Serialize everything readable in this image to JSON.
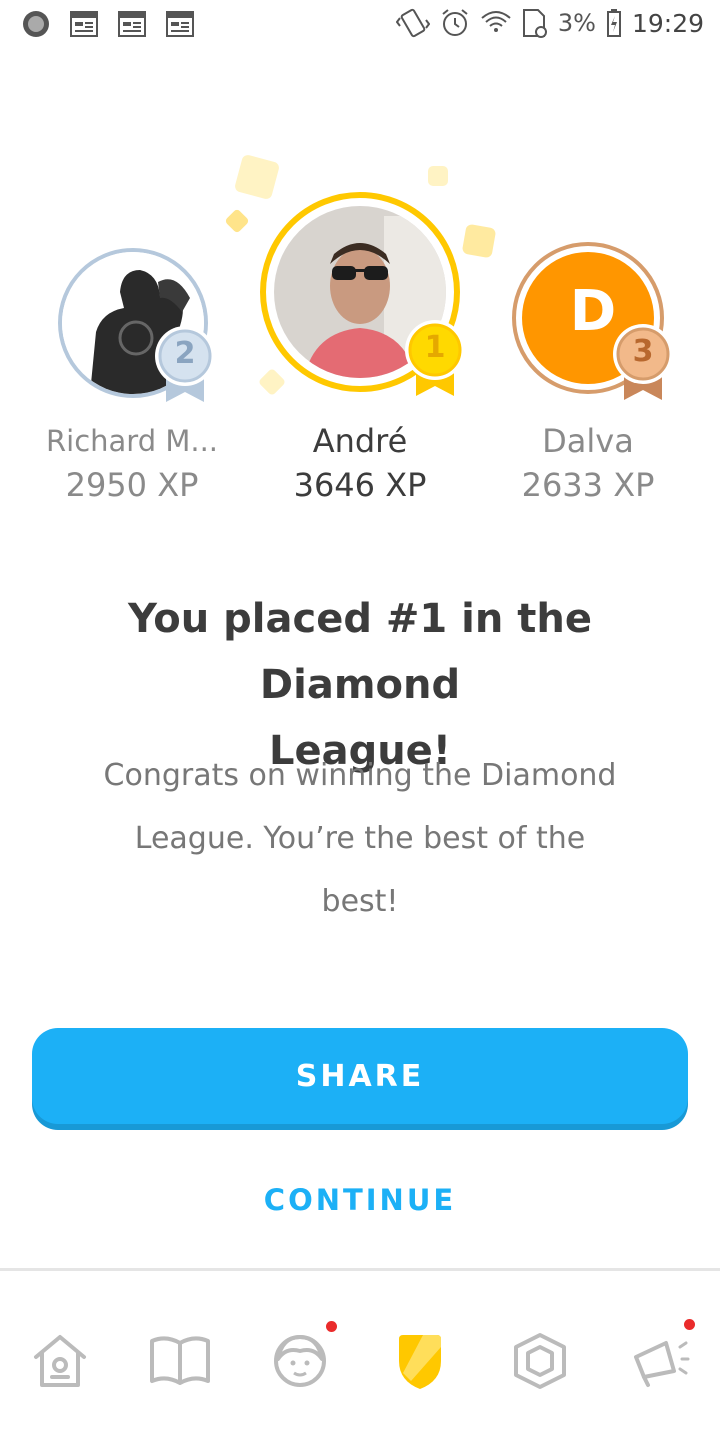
{
  "status_bar": {
    "battery": "3%",
    "time": "19:29"
  },
  "podium": {
    "second": {
      "rank": "2",
      "name": "Richard M...",
      "xp": "2950 XP"
    },
    "first": {
      "rank": "1",
      "name": "André",
      "xp": "3646 XP"
    },
    "third": {
      "rank": "3",
      "name": "Dalva",
      "xp": "2633 XP",
      "initial": "D"
    }
  },
  "main": {
    "title_line1": "You placed #1 in the Diamond",
    "title_line2": "League!",
    "subtitle_line1": "Congrats on winning the Diamond",
    "subtitle_line2": "League. You’re the best of the",
    "subtitle_line3": "best!"
  },
  "actions": {
    "share_label": "SHARE",
    "continue_label": "CONTINUE"
  },
  "bottom_nav": {
    "items": [
      {
        "icon": "home-icon",
        "active": false,
        "notification": false
      },
      {
        "icon": "book-icon",
        "active": false,
        "notification": false
      },
      {
        "icon": "profile-icon",
        "active": false,
        "notification": true
      },
      {
        "icon": "league-shield-icon",
        "active": true,
        "notification": false
      },
      {
        "icon": "gem-shop-icon",
        "active": false,
        "notification": false
      },
      {
        "icon": "megaphone-icon",
        "active": false,
        "notification": true
      }
    ]
  },
  "colors": {
    "accent_blue": "#1cb0f6",
    "gold": "#ffc800",
    "silver": "#a8c0d8",
    "bronze": "#d69c6b",
    "orange_avatar": "#ff9600"
  }
}
